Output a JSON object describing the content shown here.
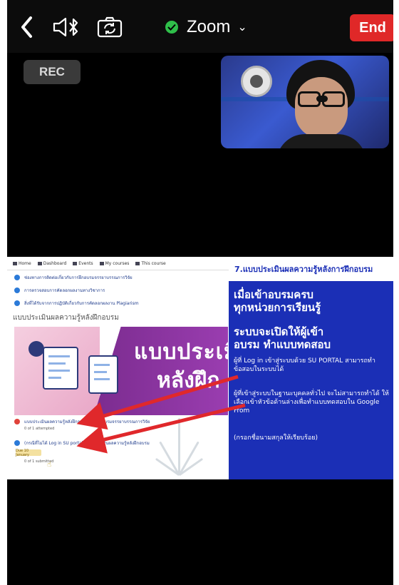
{
  "topbar": {
    "back_icon": "chevron-left-icon",
    "audio_icon": "speaker-bluetooth-icon",
    "camera_switch_icon": "camera-flip-icon",
    "meeting_title": "Zoom",
    "meeting_chevron": "⌄",
    "end_label": "End"
  },
  "recording": {
    "label": "REC"
  },
  "colors": {
    "end_red": "#e02828",
    "shield_green": "#2fbf4a",
    "slide_blue": "#1b2fb6"
  },
  "shared_screen": {
    "nav": {
      "items": [
        "Home",
        "Dashboard",
        "Events",
        "My courses",
        "This course"
      ]
    },
    "lms_items": [
      "ช่องทางการติดต่อเกี่ยวกับการฝึกอบรมจรรยาบรรณการวิจัย",
      "การตรวจสอบการคัดลอกผลงานทางวิชาการ",
      "สิ่งที่ได้รับจากการปฏิบัติเกี่ยวกับการคัดลอกผลงาน Plagiarism"
    ],
    "section_title": "แบบประเมินผลความรู้หลังฝึกอบรม",
    "banner_line1": "แบบประเมิน",
    "banner_line2": "หลังฝึก",
    "quiz_items": [
      {
        "title": "แบบประเมินผลความรู้หลังฝึกอบรม การฝึกอบรมจรรยาบรรณการวิจัย",
        "meta": "0 of 1 attempted"
      },
      {
        "title": "(กรณีที่ไม่ได้ Log in SU portal) แบบประเมินผลความรู้หลังฝึกอบรม",
        "meta": "0 of 1 submitted",
        "badge": "Due 10 January"
      }
    ],
    "slide": {
      "header": "7.แบบประเมินผลความรู้หลังการฝึกอบรม",
      "line1": "เมื่อเข้าอบรมครบ",
      "line2": "ทุกหน่วยการเรียนรู้",
      "line3": "ระบบจะเปิดให้ผู้เข้า",
      "line4": "อบรม ทำแบบทดสอบ",
      "para1": "ผู้ที่ Log in เข้าสู่ระบบด้วย SU PORTAL สามารถทำข้อสอบในระบบได้",
      "para2": "ผู้ที่เข้าสู่ระบบในฐานะบุคคลทั่วไป จะไม่สามารถทำได้ ให้เลือกเข้าหัวข้อด้านล่างเพื่อทำแบบทดสอบใน Google From",
      "para3": "(กรอกชื่อนามสกุลให้เรียบร้อย)"
    }
  }
}
